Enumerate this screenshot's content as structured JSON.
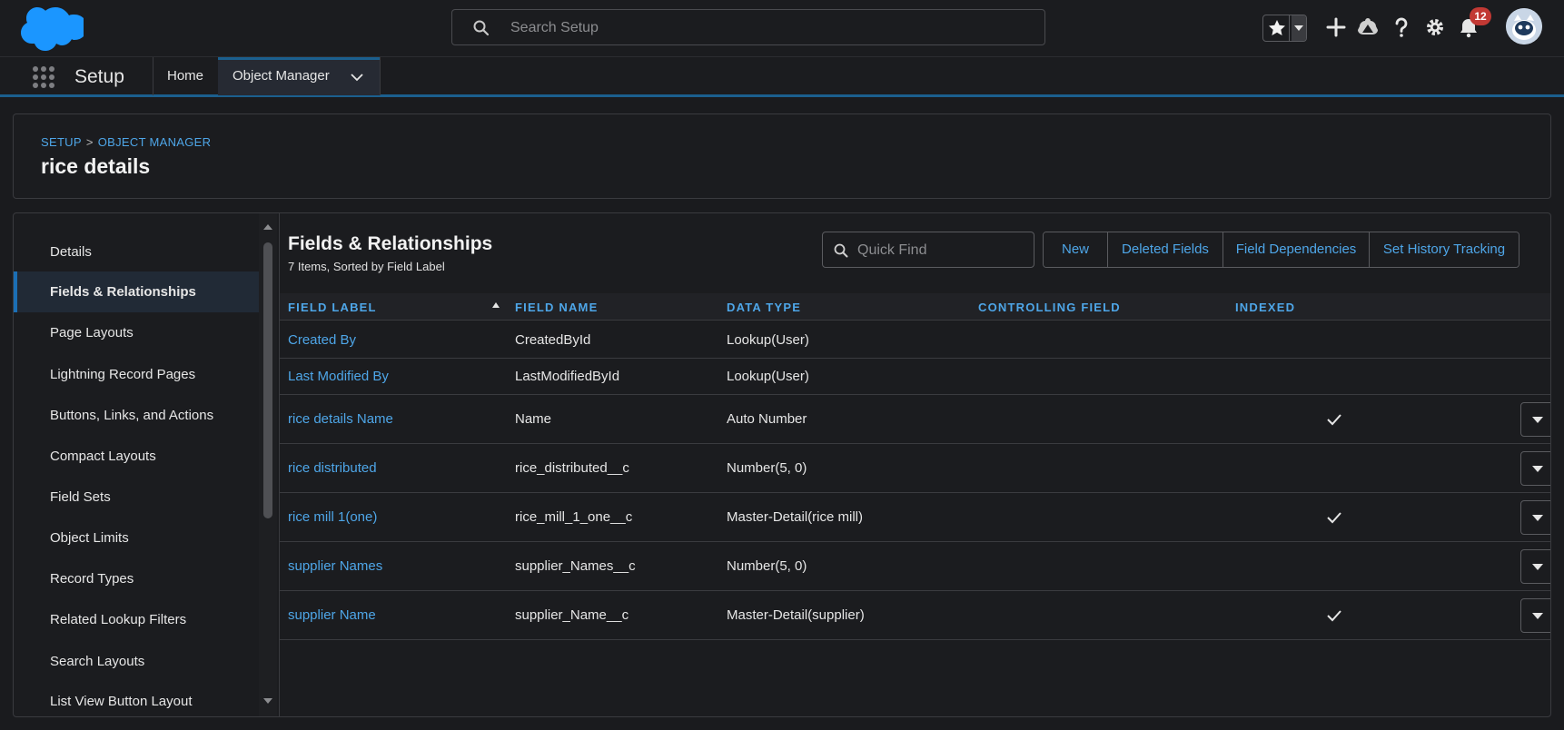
{
  "header": {
    "search_placeholder": "Search Setup",
    "notification_count": "12",
    "icons": [
      "salesforce-logo",
      "search-icon",
      "star-icon",
      "chevron-down-icon",
      "plus-icon",
      "trailhead-icon",
      "help-icon",
      "gear-icon",
      "bell-icon",
      "avatar"
    ]
  },
  "app_nav": {
    "app_name": "Setup",
    "tabs": [
      {
        "label": "Home"
      },
      {
        "label": "Object Manager"
      }
    ]
  },
  "page_header": {
    "breadcrumb": [
      "SETUP",
      "OBJECT MANAGER"
    ],
    "breadcrumb_separator": ">",
    "title": "rice details"
  },
  "sidebar": {
    "items": [
      {
        "label": "Details"
      },
      {
        "label": "Fields & Relationships",
        "active": true
      },
      {
        "label": "Page Layouts"
      },
      {
        "label": "Lightning Record Pages"
      },
      {
        "label": "Buttons, Links, and Actions"
      },
      {
        "label": "Compact Layouts"
      },
      {
        "label": "Field Sets"
      },
      {
        "label": "Object Limits"
      },
      {
        "label": "Record Types"
      },
      {
        "label": "Related Lookup Filters"
      },
      {
        "label": "Search Layouts"
      },
      {
        "label": "List View Button Layout"
      }
    ]
  },
  "section": {
    "title": "Fields & Relationships",
    "subtitle": "7 Items, Sorted by Field Label",
    "quick_find_placeholder": "Quick Find",
    "buttons": [
      "New",
      "Deleted Fields",
      "Field Dependencies",
      "Set History Tracking"
    ]
  },
  "table": {
    "columns": [
      "FIELD LABEL",
      "FIELD NAME",
      "DATA TYPE",
      "CONTROLLING FIELD",
      "INDEXED"
    ],
    "rows": [
      {
        "label": "Created By",
        "name": "CreatedById",
        "type": "Lookup(User)",
        "controlling": "",
        "indexed": false,
        "menu": false
      },
      {
        "label": "Last Modified By",
        "name": "LastModifiedById",
        "type": "Lookup(User)",
        "controlling": "",
        "indexed": false,
        "menu": false
      },
      {
        "label": "rice details Name",
        "name": "Name",
        "type": "Auto Number",
        "controlling": "",
        "indexed": true,
        "menu": true
      },
      {
        "label": "rice distributed",
        "name": "rice_distributed__c",
        "type": "Number(5, 0)",
        "controlling": "",
        "indexed": false,
        "menu": true
      },
      {
        "label": "rice mill 1(one)",
        "name": "rice_mill_1_one__c",
        "type": "Master-Detail(rice mill)",
        "controlling": "",
        "indexed": true,
        "menu": true
      },
      {
        "label": "supplier Names",
        "name": "supplier_Names__c",
        "type": "Number(5, 0)",
        "controlling": "",
        "indexed": false,
        "menu": true
      },
      {
        "label": "supplier Name",
        "name": "supplier_Name__c",
        "type": "Master-Detail(supplier)",
        "controlling": "",
        "indexed": true,
        "menu": true
      }
    ]
  },
  "colors": {
    "background": "#1a1b1e",
    "link": "#4ea6e8",
    "accent": "#1b5f8e",
    "badge": "#c23934"
  }
}
